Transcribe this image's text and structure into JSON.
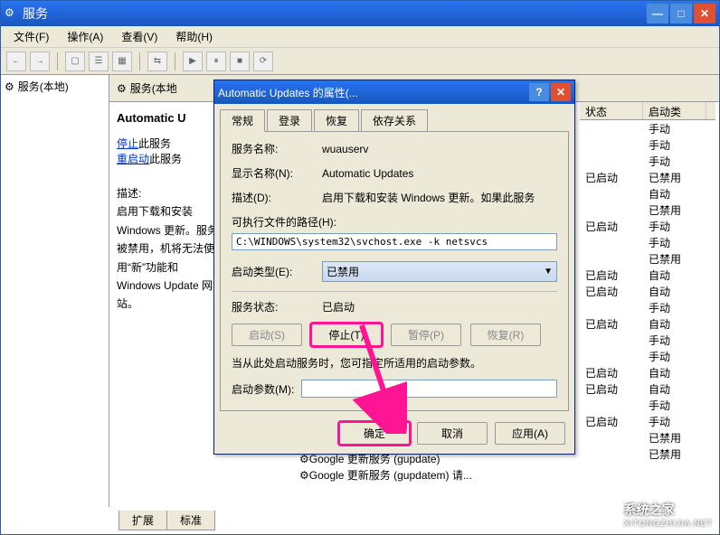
{
  "main_window": {
    "title": "服务",
    "menus": [
      "文件(F)",
      "操作(A)",
      "查看(V)",
      "帮助(H)"
    ]
  },
  "tree": {
    "root": "服务(本地)"
  },
  "detail": {
    "header": "服务(本地",
    "service_name": "Automatic U",
    "stop_link": "停止",
    "stop_suffix": "此服务",
    "restart_link": "重启动",
    "restart_suffix": "此服务",
    "desc_label": "描述:",
    "desc_body": "启用下载和安装 Windows 更新。服务被禁用，机将无法使用“新”功能和 Windows Update 网站。"
  },
  "list": {
    "cols": {
      "status": "状态",
      "startup": "启动类"
    },
    "rows": [
      {
        "status": "",
        "startup": "手动"
      },
      {
        "status": "",
        "startup": "手动"
      },
      {
        "status": "",
        "startup": "手动"
      },
      {
        "status": "已启动",
        "startup": "已禁用"
      },
      {
        "status": "",
        "startup": "自动"
      },
      {
        "status": "",
        "startup": "已禁用"
      },
      {
        "status": "已启动",
        "startup": "手动"
      },
      {
        "status": "",
        "startup": "手动"
      },
      {
        "status": "",
        "startup": "已禁用"
      },
      {
        "status": "已启动",
        "startup": "自动"
      },
      {
        "status": "已启动",
        "startup": "自动"
      },
      {
        "status": "",
        "startup": "手动"
      },
      {
        "status": "已启动",
        "startup": "自动"
      },
      {
        "status": "",
        "startup": "手动"
      },
      {
        "status": "",
        "startup": "手动"
      },
      {
        "status": "已启动",
        "startup": "自动"
      },
      {
        "status": "已启动",
        "startup": "自动"
      },
      {
        "status": "",
        "startup": "手动"
      },
      {
        "status": "已启动",
        "startup": "手动"
      },
      {
        "status": "",
        "startup": "已禁用"
      },
      {
        "status": "",
        "startup": "已禁用"
      }
    ],
    "google_rows": [
      "Google 更新服务 (gupdate)",
      "Google 更新服务 (gupdatem) 请..."
    ]
  },
  "tabs_bottom": [
    "扩展",
    "标准"
  ],
  "dialog": {
    "title": "Automatic Updates 的属性(...",
    "tabs": [
      "常规",
      "登录",
      "恢复",
      "依存关系"
    ],
    "fields": {
      "service_name_label": "服务名称:",
      "service_name_value": "wuauserv",
      "display_name_label": "显示名称(N):",
      "display_name_value": "Automatic Updates",
      "desc_label": "描述(D):",
      "desc_value": "启用下载和安装 Windows 更新。如果此服务",
      "exe_label": "可执行文件的路径(H):",
      "exe_value": "C:\\WINDOWS\\system32\\svchost.exe -k netsvcs",
      "startup_label": "启动类型(E):",
      "startup_value": "已禁用",
      "status_label": "服务状态:",
      "status_value": "已启动"
    },
    "buttons": {
      "start": "启动(S)",
      "stop": "停止(T)",
      "pause": "暂停(P)",
      "resume": "恢复(R)"
    },
    "hint": "当从此处启动服务时，您可指定所适用的启动参数。",
    "start_params_label": "启动参数(M):",
    "ok": "确定",
    "cancel": "取消",
    "apply": "应用(A)"
  },
  "watermark": {
    "cn": "系统之家",
    "en": "XITONGZHIJIA.NET"
  }
}
